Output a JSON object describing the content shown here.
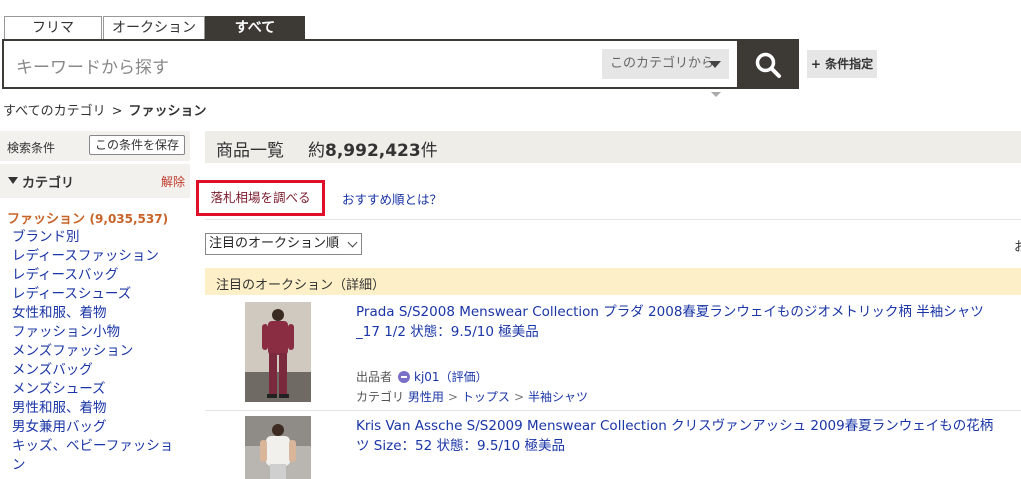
{
  "tabs": [
    "フリマ",
    "オークション",
    "すべて"
  ],
  "search": {
    "placeholder": "キーワードから探す",
    "scope_label": "このカテゴリから",
    "condition_button": "+ 条件指定"
  },
  "breadcrumb": {
    "root": "すべてのカテゴリ",
    "separator": ">",
    "current": "ファッション"
  },
  "sidebar": {
    "conditions_label": "検索条件",
    "save_button": "この条件を保存",
    "category_title": "カテゴリ",
    "clear_label": "解除",
    "current_category": "ファッション",
    "current_count": "(9,035,537)",
    "items": [
      "ブランド別",
      "レディースファッション",
      "レディースバッグ",
      "レディースシューズ",
      "女性和服、着物",
      "ファッション小物",
      "メンズファッション",
      "メンズバッグ",
      "メンズシューズ",
      "男性和服、着物",
      "男女兼用バッグ",
      "キッズ、ベビーファッショ",
      "ン"
    ]
  },
  "main": {
    "list_title": "商品一覧",
    "count_prefix": "約",
    "count_value": "8,992,423",
    "count_suffix": "件",
    "market_button": "落札相場を調べる",
    "recommend_link": "おすすめ順とは？",
    "sort_selected": "注目のオークション順",
    "right_cutoff": "お",
    "feature_label": "注目のオークション（詳細）"
  },
  "items": [
    {
      "title_line1": "Prada S/S2008 Menswear Collection プラダ 2008春夏ランウェイものジオメトリック柄 半袖シャツ",
      "title_line2": "_17 1/2 状態：9.5/10 極美品",
      "seller_label": "出品者",
      "seller_name": "kj01（評価）",
      "category_label": "カテゴリ",
      "category_path": [
        "男性用",
        "トップス",
        "半袖シャツ"
      ]
    },
    {
      "title_line1": "Kris Van Assche S/S2009 Menswear Collection クリスヴァンアッシュ 2009春夏ランウェイもの花柄",
      "title_line2": "ツ Size：52 状態：9.5/10 極美品"
    }
  ],
  "colors": {
    "dark": "#3d3a36",
    "link": "#1a35a6",
    "highlight_red": "#e0102a",
    "current_category": "#c86428",
    "feature_bar": "#fdf0c8"
  }
}
